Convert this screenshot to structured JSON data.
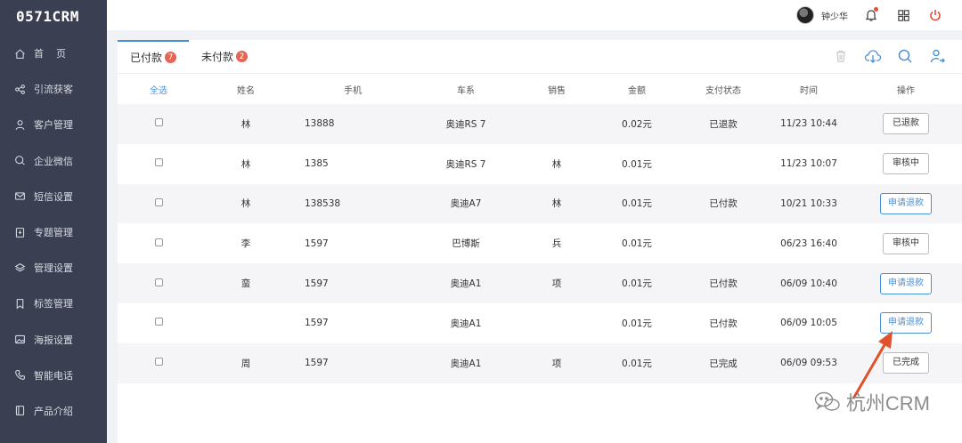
{
  "app": {
    "logo": "0571CRM"
  },
  "sidebar": {
    "items": [
      {
        "label": "首    页",
        "icon": "home-icon"
      },
      {
        "label": "引流获客",
        "icon": "share-icon"
      },
      {
        "label": "客户管理",
        "icon": "user-icon"
      },
      {
        "label": "企业微信",
        "icon": "chat-icon"
      },
      {
        "label": "短信设置",
        "icon": "mail-icon"
      },
      {
        "label": "专题管理",
        "icon": "topic-icon"
      },
      {
        "label": "管理设置",
        "icon": "layers-icon"
      },
      {
        "label": "标签管理",
        "icon": "bookmark-icon"
      },
      {
        "label": "海报设置",
        "icon": "image-icon"
      },
      {
        "label": "智能电话",
        "icon": "phone-icon"
      },
      {
        "label": "产品介绍",
        "icon": "book-icon"
      }
    ]
  },
  "header": {
    "user_name": "钟少华"
  },
  "tabs": [
    {
      "label": "已付款",
      "count": "7"
    },
    {
      "label": "未付款",
      "count": "2"
    }
  ],
  "table": {
    "columns": [
      "全选",
      "姓名",
      "手机",
      "车系",
      "销售",
      "金额",
      "支付状态",
      "时间",
      "操作"
    ],
    "rows": [
      {
        "name": "林",
        "phone": "13888",
        "series": "奥迪RS 7",
        "sales": "",
        "amount": "0.02元",
        "status": "已退款",
        "time": "11/23 10:44",
        "action": "已退款",
        "action_style": "gray"
      },
      {
        "name": "林",
        "phone": "1385",
        "series": "奥迪RS 7",
        "sales": "林",
        "amount": "0.01元",
        "status": "",
        "time": "11/23 10:07",
        "action": "审核中",
        "action_style": "gray"
      },
      {
        "name": "林",
        "phone": "138538",
        "series": "奥迪A7",
        "sales": "林",
        "amount": "0.01元",
        "status": "已付款",
        "time": "10/21 10:33",
        "action": "申请退款",
        "action_style": "blue"
      },
      {
        "name": "李",
        "phone": "1597",
        "series": "巴博斯",
        "sales": "兵",
        "amount": "0.01元",
        "status": "",
        "time": "06/23 16:40",
        "action": "审核中",
        "action_style": "gray"
      },
      {
        "name": "蛮",
        "phone": "1597",
        "series": "奥迪A1",
        "sales": "项",
        "amount": "0.01元",
        "status": "已付款",
        "time": "06/09 10:40",
        "action": "申请退款",
        "action_style": "blue"
      },
      {
        "name": "",
        "phone": "1597",
        "series": "奥迪A1",
        "sales": "",
        "amount": "0.01元",
        "status": "已付款",
        "time": "06/09 10:05",
        "action": "申请退款",
        "action_style": "blue"
      },
      {
        "name": "周",
        "phone": "1597",
        "series": "奥迪A1",
        "sales": "项",
        "amount": "0.01元",
        "status": "已完成",
        "time": "06/09 09:53",
        "action": "已完成",
        "action_style": "gray"
      }
    ]
  },
  "watermark": {
    "text": "杭州CRM"
  },
  "colors": {
    "sidebar_bg": "#3a3f51",
    "accent": "#4a90d9",
    "badge": "#e96352",
    "arrow": "#e0522b"
  }
}
